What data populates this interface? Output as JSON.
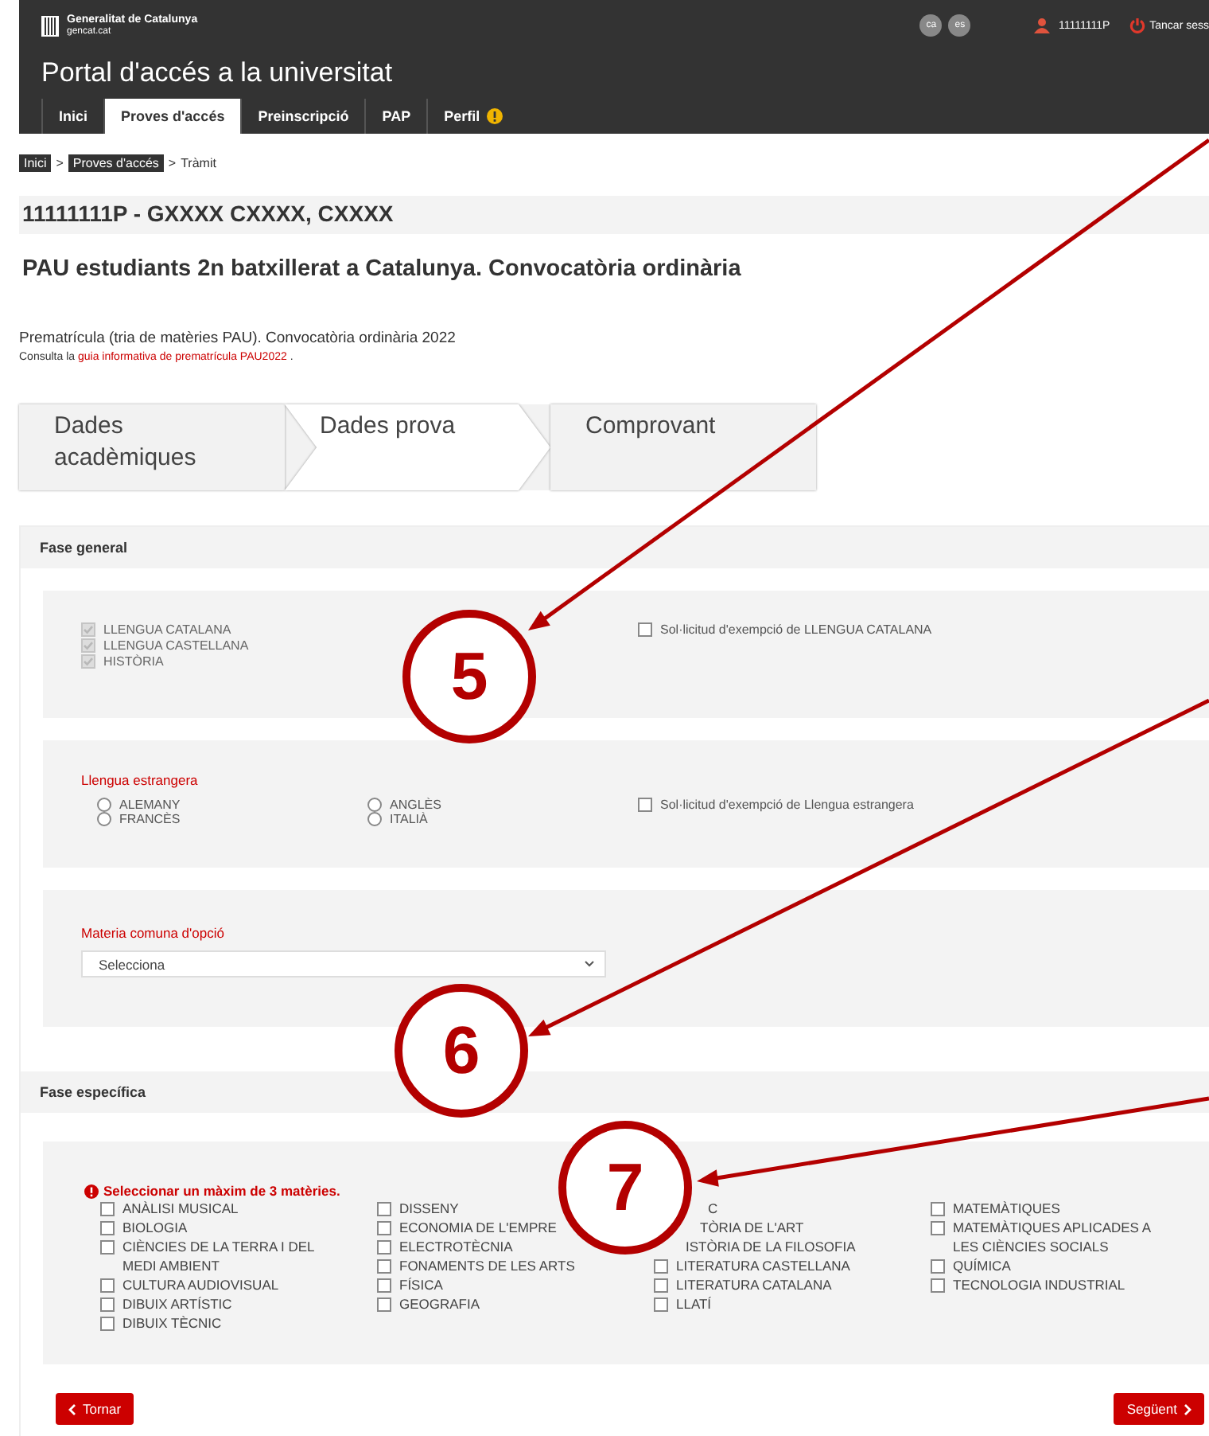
{
  "header": {
    "org_line1": "Generalitat de Catalunya",
    "org_line2": "gencat.cat",
    "languages": [
      {
        "label": "ca"
      },
      {
        "label": "es"
      }
    ],
    "user": "11111111P",
    "logout": "Tancar sess",
    "title": "Portal d'accés a la universitat"
  },
  "tabs": [
    {
      "label": "Inici",
      "selected": false,
      "warning": false
    },
    {
      "label": "Proves d'accés",
      "selected": true,
      "warning": false
    },
    {
      "label": "Preinscripció",
      "selected": false,
      "warning": false
    },
    {
      "label": "PAP",
      "selected": false,
      "warning": false
    },
    {
      "label": "Perfil",
      "selected": false,
      "warning": true
    }
  ],
  "breadcrumb": [
    {
      "label": "Inici",
      "kind": "link"
    },
    {
      "label": ">",
      "kind": "separator"
    },
    {
      "label": "Proves d'accés",
      "kind": "link"
    },
    {
      "label": ">",
      "kind": "separator"
    },
    {
      "label": "Tràmit",
      "kind": "current"
    }
  ],
  "person": "11111111P - GXXXX CXXXX, CXXXX",
  "heading": "PAU estudiants 2n batxillerat a Catalunya. Convocatòria ordinària",
  "subtitle": "Prematrícula (tria de matèries PAU). Convocatòria ordinària 2022",
  "info": {
    "prefix": "Consulta la",
    "link": "guia informativa de prematrícula PAU2022",
    "suffix": "."
  },
  "steps": [
    {
      "label": "Dades acadèmiques",
      "selected": false
    },
    {
      "label": "Dades prova",
      "selected": true
    },
    {
      "label": "Comprovant",
      "selected": false
    }
  ],
  "fase_general": {
    "title": "Fase general",
    "common": [
      {
        "label": "LLENGUA CATALANA",
        "checked": true,
        "disabled": true
      },
      {
        "label": "LLENGUA CASTELLANA",
        "checked": true,
        "disabled": true
      },
      {
        "label": "HISTÒRIA",
        "checked": true,
        "disabled": true
      }
    ],
    "exemption_catalan": {
      "label": "Sol·licitud d'exempció de LLENGUA CATALANA",
      "checked": false
    },
    "foreign_language": {
      "title": "Llengua estrangera",
      "options": [
        {
          "label": "ALEMANY",
          "selected": false
        },
        {
          "label": "FRANCÈS",
          "selected": false
        },
        {
          "label": "ANGLÈS",
          "selected": false
        },
        {
          "label": "ITALIÀ",
          "selected": false
        }
      ],
      "exemption": {
        "label": "Sol·licitud d'exempció de Llengua estrangera",
        "checked": false
      }
    },
    "optional": {
      "title": "Materia comuna d'opció",
      "placeholder": "Selecciona"
    }
  },
  "fase_especifica": {
    "title": "Fase específica",
    "warning": "Seleccionar un màxim de 3 matèries.",
    "columns": [
      [
        {
          "label": "ANÀLISI MUSICAL",
          "kind": "checkbox",
          "checked": false
        },
        {
          "label": "BIOLOGIA",
          "kind": "checkbox",
          "checked": false
        },
        {
          "label": "CIÈNCIES DE LA TERRA I DEL MEDI AMBIENT",
          "kind": "checkbox",
          "checked": false
        },
        {
          "label": "CULTURA AUDIOVISUAL",
          "kind": "checkbox",
          "checked": false
        },
        {
          "label": "DIBUIX ARTÍSTIC",
          "kind": "checkbox",
          "checked": false
        },
        {
          "label": "DIBUIX TÈCNIC",
          "kind": "checkbox",
          "checked": false
        }
      ],
      [
        {
          "label": "DISSENY",
          "kind": "checkbox",
          "checked": false
        },
        {
          "label": "ECONOMIA DE L'EMPRE",
          "kind": "checkbox",
          "checked": false
        },
        {
          "label": "ELECTROTÈCNIA",
          "kind": "checkbox",
          "checked": false
        },
        {
          "label": "FONAMENTS DE LES ARTS",
          "kind": "checkbox",
          "checked": false
        },
        {
          "label": "FÍSICA",
          "kind": "checkbox",
          "checked": false
        },
        {
          "label": "GEOGRAFIA",
          "kind": "checkbox",
          "checked": false
        }
      ],
      [
        {
          "label": "C",
          "kind": "covered"
        },
        {
          "label": "TÒRIA DE L'ART",
          "kind": "covered"
        },
        {
          "label": "ISTÒRIA DE LA FILOSOFIA",
          "kind": "covered"
        },
        {
          "label": "LITERATURA CASTELLANA",
          "kind": "checkbox",
          "checked": false
        },
        {
          "label": "LITERATURA CATALANA",
          "kind": "checkbox",
          "checked": false
        },
        {
          "label": "LLATÍ",
          "kind": "checkbox",
          "checked": false
        }
      ],
      [
        {
          "label": "MATEMÀTIQUES",
          "kind": "checkbox",
          "checked": false
        },
        {
          "label": "MATEMÀTIQUES APLICADES A LES CIÈNCIES SOCIALS",
          "kind": "checkbox",
          "checked": false
        },
        {
          "label": "QUÍMICA",
          "kind": "checkbox",
          "checked": false
        },
        {
          "label": "TECNOLOGIA INDUSTRIAL",
          "kind": "checkbox",
          "checked": false
        }
      ]
    ]
  },
  "buttons": {
    "back": "Tornar",
    "next": "Següent"
  },
  "callouts": [
    {
      "number": "5"
    },
    {
      "number": "6"
    },
    {
      "number": "7"
    }
  ]
}
